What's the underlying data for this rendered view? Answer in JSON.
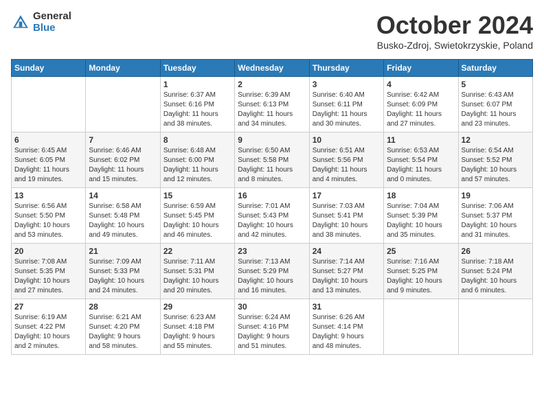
{
  "header": {
    "logo_general": "General",
    "logo_blue": "Blue",
    "month_title": "October 2024",
    "subtitle": "Busko-Zdroj, Swietokrzyskie, Poland"
  },
  "weekdays": [
    "Sunday",
    "Monday",
    "Tuesday",
    "Wednesday",
    "Thursday",
    "Friday",
    "Saturday"
  ],
  "weeks": [
    [
      {
        "day": "",
        "info": ""
      },
      {
        "day": "",
        "info": ""
      },
      {
        "day": "1",
        "info": "Sunrise: 6:37 AM\nSunset: 6:16 PM\nDaylight: 11 hours\nand 38 minutes."
      },
      {
        "day": "2",
        "info": "Sunrise: 6:39 AM\nSunset: 6:13 PM\nDaylight: 11 hours\nand 34 minutes."
      },
      {
        "day": "3",
        "info": "Sunrise: 6:40 AM\nSunset: 6:11 PM\nDaylight: 11 hours\nand 30 minutes."
      },
      {
        "day": "4",
        "info": "Sunrise: 6:42 AM\nSunset: 6:09 PM\nDaylight: 11 hours\nand 27 minutes."
      },
      {
        "day": "5",
        "info": "Sunrise: 6:43 AM\nSunset: 6:07 PM\nDaylight: 11 hours\nand 23 minutes."
      }
    ],
    [
      {
        "day": "6",
        "info": "Sunrise: 6:45 AM\nSunset: 6:05 PM\nDaylight: 11 hours\nand 19 minutes."
      },
      {
        "day": "7",
        "info": "Sunrise: 6:46 AM\nSunset: 6:02 PM\nDaylight: 11 hours\nand 15 minutes."
      },
      {
        "day": "8",
        "info": "Sunrise: 6:48 AM\nSunset: 6:00 PM\nDaylight: 11 hours\nand 12 minutes."
      },
      {
        "day": "9",
        "info": "Sunrise: 6:50 AM\nSunset: 5:58 PM\nDaylight: 11 hours\nand 8 minutes."
      },
      {
        "day": "10",
        "info": "Sunrise: 6:51 AM\nSunset: 5:56 PM\nDaylight: 11 hours\nand 4 minutes."
      },
      {
        "day": "11",
        "info": "Sunrise: 6:53 AM\nSunset: 5:54 PM\nDaylight: 11 hours\nand 0 minutes."
      },
      {
        "day": "12",
        "info": "Sunrise: 6:54 AM\nSunset: 5:52 PM\nDaylight: 10 hours\nand 57 minutes."
      }
    ],
    [
      {
        "day": "13",
        "info": "Sunrise: 6:56 AM\nSunset: 5:50 PM\nDaylight: 10 hours\nand 53 minutes."
      },
      {
        "day": "14",
        "info": "Sunrise: 6:58 AM\nSunset: 5:48 PM\nDaylight: 10 hours\nand 49 minutes."
      },
      {
        "day": "15",
        "info": "Sunrise: 6:59 AM\nSunset: 5:45 PM\nDaylight: 10 hours\nand 46 minutes."
      },
      {
        "day": "16",
        "info": "Sunrise: 7:01 AM\nSunset: 5:43 PM\nDaylight: 10 hours\nand 42 minutes."
      },
      {
        "day": "17",
        "info": "Sunrise: 7:03 AM\nSunset: 5:41 PM\nDaylight: 10 hours\nand 38 minutes."
      },
      {
        "day": "18",
        "info": "Sunrise: 7:04 AM\nSunset: 5:39 PM\nDaylight: 10 hours\nand 35 minutes."
      },
      {
        "day": "19",
        "info": "Sunrise: 7:06 AM\nSunset: 5:37 PM\nDaylight: 10 hours\nand 31 minutes."
      }
    ],
    [
      {
        "day": "20",
        "info": "Sunrise: 7:08 AM\nSunset: 5:35 PM\nDaylight: 10 hours\nand 27 minutes."
      },
      {
        "day": "21",
        "info": "Sunrise: 7:09 AM\nSunset: 5:33 PM\nDaylight: 10 hours\nand 24 minutes."
      },
      {
        "day": "22",
        "info": "Sunrise: 7:11 AM\nSunset: 5:31 PM\nDaylight: 10 hours\nand 20 minutes."
      },
      {
        "day": "23",
        "info": "Sunrise: 7:13 AM\nSunset: 5:29 PM\nDaylight: 10 hours\nand 16 minutes."
      },
      {
        "day": "24",
        "info": "Sunrise: 7:14 AM\nSunset: 5:27 PM\nDaylight: 10 hours\nand 13 minutes."
      },
      {
        "day": "25",
        "info": "Sunrise: 7:16 AM\nSunset: 5:25 PM\nDaylight: 10 hours\nand 9 minutes."
      },
      {
        "day": "26",
        "info": "Sunrise: 7:18 AM\nSunset: 5:24 PM\nDaylight: 10 hours\nand 6 minutes."
      }
    ],
    [
      {
        "day": "27",
        "info": "Sunrise: 6:19 AM\nSunset: 4:22 PM\nDaylight: 10 hours\nand 2 minutes."
      },
      {
        "day": "28",
        "info": "Sunrise: 6:21 AM\nSunset: 4:20 PM\nDaylight: 9 hours\nand 58 minutes."
      },
      {
        "day": "29",
        "info": "Sunrise: 6:23 AM\nSunset: 4:18 PM\nDaylight: 9 hours\nand 55 minutes."
      },
      {
        "day": "30",
        "info": "Sunrise: 6:24 AM\nSunset: 4:16 PM\nDaylight: 9 hours\nand 51 minutes."
      },
      {
        "day": "31",
        "info": "Sunrise: 6:26 AM\nSunset: 4:14 PM\nDaylight: 9 hours\nand 48 minutes."
      },
      {
        "day": "",
        "info": ""
      },
      {
        "day": "",
        "info": ""
      }
    ]
  ]
}
